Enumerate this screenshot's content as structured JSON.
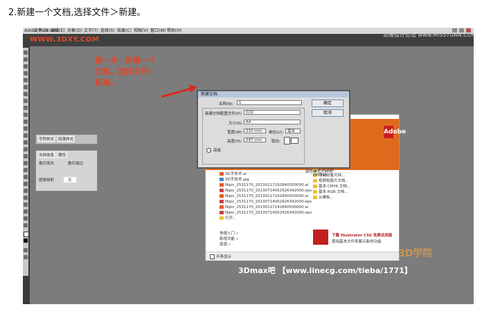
{
  "heading": "2.新建一个文档,选择文件＞新建。",
  "menu": [
    "Adobe Illustrator",
    "文件(F)",
    "编辑(E)",
    "对象(O)",
    "文字(T)",
    "选择(S)",
    "效果(C)",
    "视图(V)",
    "窗口(W)",
    "帮助(H)"
  ],
  "watermark_left": "WWW.3DXY.COM",
  "watermark_right": "思缘设计论坛 www.MISSYUAN.COM",
  "annotation": "第一步：新建一个文档。选择文件〉新建。",
  "panels": {
    "tabs_top": [
      "字符样式",
      "段落样式"
    ],
    "tabs_bottom": [
      "文档信息",
      "属性"
    ],
    "opt1": "叠印填充",
    "opt2": "叠印描边",
    "opt3": "图像映射",
    "opt4": "无"
  },
  "dialog": {
    "title": "新建文档",
    "name_label": "名称(N):",
    "name_value": "1",
    "profile_label": "新建文档配置文件(P):",
    "profile_value": "打印",
    "size_label": "大小(S):",
    "size_value": "A4",
    "width_label": "宽度(W):",
    "width_value": "210 mm",
    "units_label": "单位(U):",
    "units_value": "毫米",
    "height_label": "高度(H):",
    "height_value": "297 mm",
    "orient_label": "取向:",
    "advanced_label": "高级",
    "color_mode": "颜色模式:CMYK",
    "ppi": "PPI:300",
    "ok": "确定",
    "cancel": "取消"
  },
  "welcome": {
    "recent_files": [
      "3D字技术.ai",
      "3D字技术.jpg",
      "Nipic_2531170_20130117192840500000.ai",
      "Nipic_2531170_20130714002926342000.eps",
      "Nipic_2531170_20130117192840500000.ai",
      "Nipic_2531170_20130714002926342000.eps",
      "Nipic_2531170_20130117192840500000.ai",
      "Nipic_2531170_20130714002926342000.eps"
    ],
    "open_label": "打开...",
    "new_items": [
      "打印文档",
      "移动设备文档...",
      "视频和胶片文档...",
      "基本 CMYK 文档...",
      "基本 RGB 文档...",
      "从模板..."
    ],
    "links": [
      "快速入门 »",
      "新增功能 »",
      "资源 »"
    ],
    "promo_title": "下载 Illustrator CS6 免费试用版",
    "promo_sub": "使用基本文件来展示新的功能",
    "dont_show": "不再显示",
    "adobe": "Adobe"
  },
  "footer_text": "3Dmax吧 【www.linecg.com/tieba/1771】",
  "logo_text": "3D学院"
}
